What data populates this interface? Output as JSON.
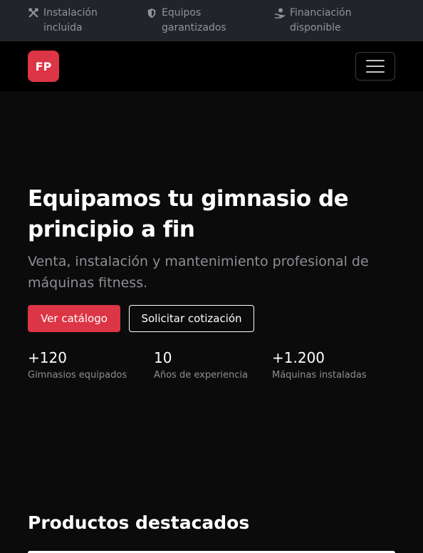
{
  "topbar": {
    "items": [
      {
        "icon": "tools-icon",
        "label": "Instalación incluida"
      },
      {
        "icon": "shield-icon",
        "label": "Equipos garantizados"
      },
      {
        "icon": "hand-money-icon",
        "label": "Financiación disponible"
      }
    ]
  },
  "navbar": {
    "logo_text": "FP",
    "menu_icon": "hamburger-menu-icon"
  },
  "hero": {
    "title": "Equipamos tu gimnasio de principio a fin",
    "subtitle": "Venta, instalación y mantenimiento profesional de máquinas fitness.",
    "primary_button": "Ver catálogo",
    "secondary_button": "Solicitar cotización",
    "stats": [
      {
        "value": "+120",
        "label": "Gimnasios equipados"
      },
      {
        "value": "10",
        "label": "Años de experiencia"
      },
      {
        "value": "+1.200",
        "label": "Máquinas instaladas"
      }
    ]
  },
  "products": {
    "title": "Productos destacados"
  },
  "colors": {
    "accent": "#dc3545",
    "topbar_bg": "#212529",
    "nav_bg": "#000000",
    "page_bg": "#0b0b0c"
  }
}
